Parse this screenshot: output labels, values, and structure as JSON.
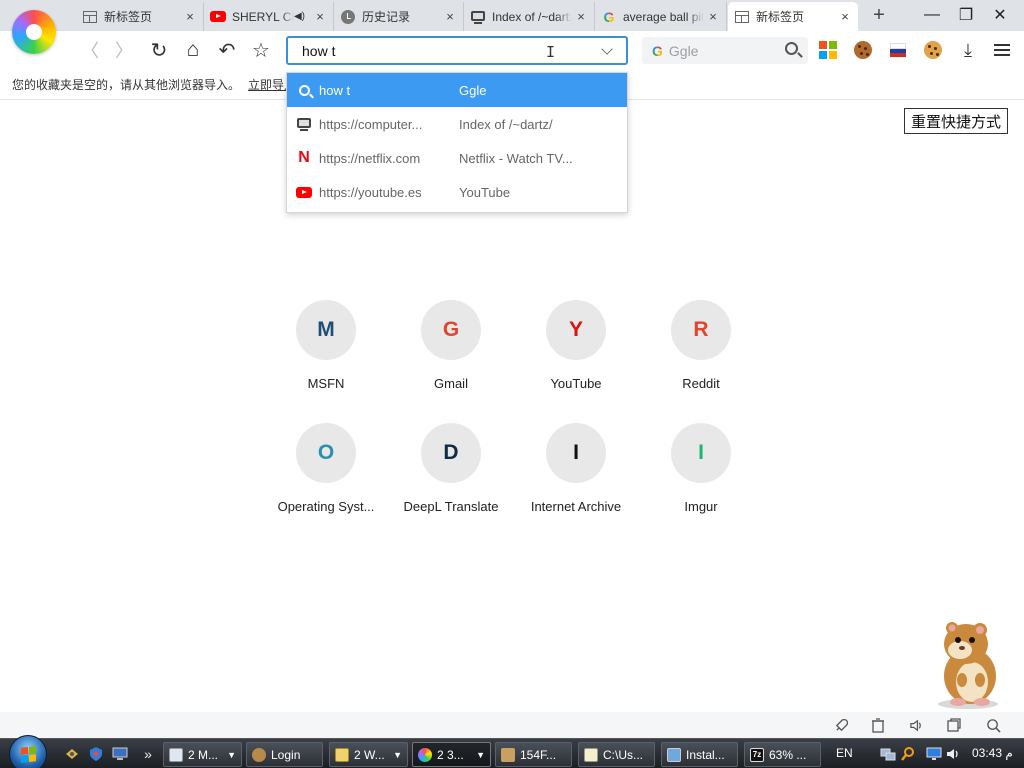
{
  "tabs": [
    {
      "label": "新标签页",
      "icon": "grid-icon"
    },
    {
      "label": "SHERYL CROW",
      "icon": "youtube-icon",
      "muted_icon": "speaker-icon"
    },
    {
      "label": "历史记录",
      "icon": "history-clock-icon"
    },
    {
      "label": "Index of /~dartz/",
      "icon": "terminal-icon"
    },
    {
      "label": "average ball pit",
      "icon": "google-icon"
    },
    {
      "label": "新标签页",
      "icon": "grid-icon",
      "active": true
    }
  ],
  "tab_close_glyph": "×",
  "new_tab_glyph": "+",
  "window_controls": {
    "minimize": "—",
    "restore": "❐",
    "close": "✕"
  },
  "toolbar": {
    "back": "〈",
    "forward": "〉",
    "reload": "↻",
    "home": "⌂",
    "undo": "↶",
    "star": "☆",
    "address_value": "how t",
    "search_placeholder": "Ggle",
    "search_engine_letter": "G",
    "download": "⤓"
  },
  "bookmarks_bar": {
    "message": "您的收藏夹是空的，请从其他浏览器导入。",
    "link": "立即导入..."
  },
  "suggestions": [
    {
      "url": "how t",
      "title": "Ggle",
      "icon": "search-icon",
      "selected": true
    },
    {
      "url": "https://computer...",
      "title": "Index of /~dartz/",
      "icon": "terminal-icon"
    },
    {
      "url": "https://netflix.com",
      "title": "Netflix - Watch TV...",
      "icon": "netflix-icon",
      "icon_glyph": "N"
    },
    {
      "url": "https://youtube.es",
      "title": "YouTube",
      "icon": "youtube-icon"
    }
  ],
  "reset_shortcuts_label": "重置快捷方式",
  "shortcuts": [
    {
      "letter": "M",
      "name": "MSFN",
      "color": "#1f4e79"
    },
    {
      "letter": "G",
      "name": "Gmail",
      "color": "#e0452e"
    },
    {
      "letter": "Y",
      "name": "YouTube",
      "color": "#e01010"
    },
    {
      "letter": "R",
      "name": "Reddit",
      "color": "#e0452e"
    },
    {
      "letter": "O",
      "name": "Operating Syst...",
      "color": "#2a8fb3"
    },
    {
      "letter": "D",
      "name": "DeepL Translate",
      "color": "#0f2b46"
    },
    {
      "letter": "I",
      "name": "Internet Archive",
      "color": "#111111"
    },
    {
      "letter": "I",
      "name": "Imgur",
      "color": "#1bb76e"
    }
  ],
  "bottom_icons": [
    "rocket-icon",
    "trash-icon",
    "speaker-icon",
    "window-icon",
    "zoom-icon"
  ],
  "taskbar": {
    "buttons": [
      {
        "label": "2 M...",
        "icon": "window-icon",
        "dropdown": true
      },
      {
        "label": "Login",
        "icon": "person-icon"
      },
      {
        "label": "2 W...",
        "icon": "document-icon",
        "dropdown": true
      },
      {
        "label": "2 3...",
        "icon": "browser-icon",
        "dropdown": true,
        "active": true
      },
      {
        "label": "154F...",
        "icon": "app-icon"
      },
      {
        "label": "C:\\Us...",
        "icon": "notepad-icon"
      },
      {
        "label": "Instal...",
        "icon": "installer-icon"
      },
      {
        "label": "63% ...",
        "icon": "7zip-icon"
      }
    ],
    "quick_launch_more": "»",
    "language": "EN",
    "time": "03:43",
    "time_suffix": "م"
  }
}
